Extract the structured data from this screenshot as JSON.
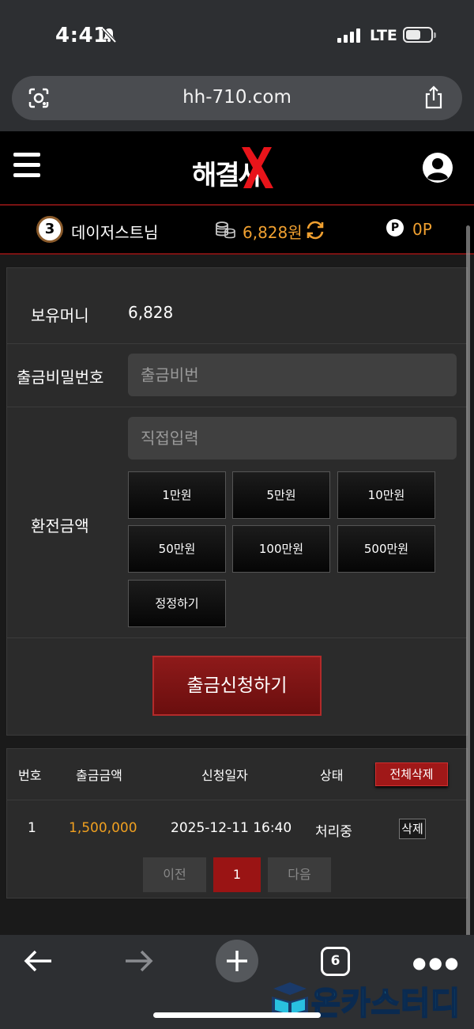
{
  "status_bar": {
    "time": "4:41",
    "network": "LTE"
  },
  "browser": {
    "url": "hh-710.com",
    "tab_count": "6"
  },
  "header": {
    "logo_text": "해결사"
  },
  "user_info": {
    "level": "3",
    "username": "데이저스트님",
    "money": "6,828원",
    "points": "0P",
    "point_badge": "P"
  },
  "withdraw_form": {
    "balance_label": "보유머니",
    "balance_value": "6,828",
    "password_label": "출금비밀번호",
    "password_placeholder": "출금비번",
    "amount_label": "환전금액",
    "amount_placeholder": "직접입력",
    "amount_buttons": [
      "1만원",
      "5만원",
      "10만원",
      "50만원",
      "100만원",
      "500만원"
    ],
    "reset_label": "정정하기",
    "submit_label": "출금신청하기"
  },
  "history": {
    "columns": [
      "번호",
      "출금금액",
      "신청일자",
      "상태"
    ],
    "delete_all_label": "전체삭제",
    "rows": [
      {
        "no": "1",
        "amount": "1,500,000",
        "date": "2025-12-11 16:40",
        "status": "처리중",
        "delete_label": "삭제"
      }
    ],
    "pagination": {
      "prev": "이전",
      "current": "1",
      "next": "다음"
    }
  },
  "watermark": {
    "text": "온카스터디"
  },
  "colors": {
    "accent_red": "#9a1414",
    "money_orange": "#f0a030",
    "background": "#000000"
  }
}
